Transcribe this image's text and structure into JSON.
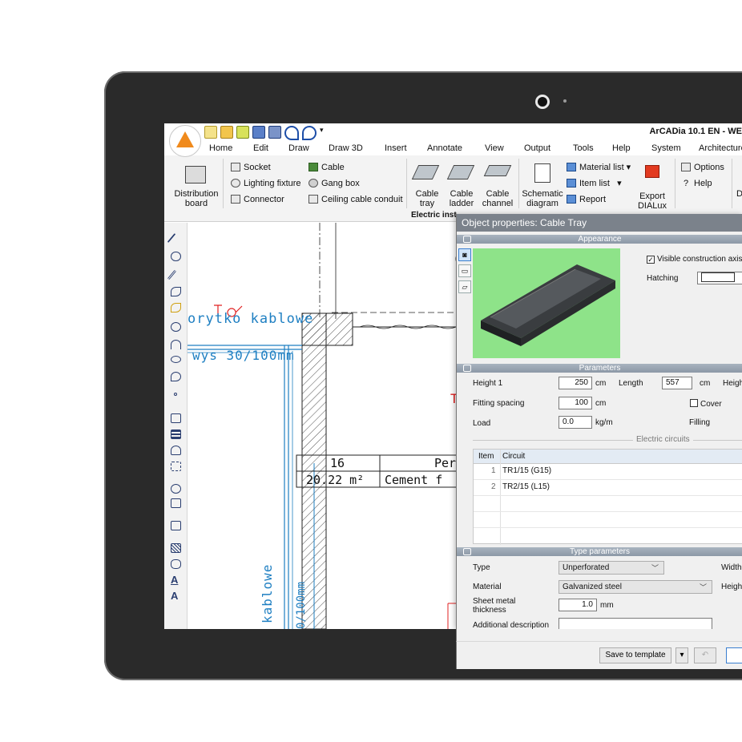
{
  "app": {
    "title": "ArCADia 10.1 EN - WE"
  },
  "menu": [
    "Home",
    "Edit",
    "Draw",
    "Draw 3D",
    "Insert",
    "Annotate",
    "View",
    "Output",
    "Tools",
    "Help",
    "System",
    "Architecture"
  ],
  "ribbon": {
    "distribution_board": "Distribution board",
    "socket": "Socket",
    "lighting_fixture": "Lighting fixture",
    "connector": "Connector",
    "cable": "Cable",
    "gang_box": "Gang box",
    "ceiling_cable_conduit": "Ceiling cable conduit",
    "cable_tray": "Cable tray",
    "cable_ladder": "Cable ladder",
    "cable_channel": "Cable channel",
    "schematic_diagram": "Schematic diagram",
    "material_list": "Material list",
    "item_list": "Item list",
    "report": "Report",
    "export_dialux": "Export DIALux",
    "options": "Options",
    "help": "Help",
    "group_label": "Electric inst",
    "trailing": "D"
  },
  "drawing": {
    "label_korytko": "orytko kablowe",
    "label_wys": "wys 30/100mm",
    "label_vertical": "kablowe",
    "label_vertical2": "0/100mm",
    "table_num": "16",
    "table_area": "20.22 m²",
    "table_col3": "Per",
    "table_col4": "Cement f",
    "red_letter": "T"
  },
  "dialog": {
    "title": "Object properties: Cable Tray",
    "sections": {
      "appearance": "Appearance",
      "parameters": "Parameters",
      "type_parameters": "Type parameters"
    },
    "appearance": {
      "visible_axis": "Visible construction axis",
      "hatching_label": "Hatching"
    },
    "parameters": {
      "height1_label": "Height 1",
      "height1_value": "250",
      "height1_unit": "cm",
      "length_label": "Length",
      "length_value": "557",
      "length_unit": "cm",
      "height_trunc": "Heigh",
      "fitting_label": "Fitting spacing",
      "fitting_value": "100",
      "fitting_unit": "cm",
      "cover_label": "Cover",
      "load_label": "Load",
      "load_value": "0.0",
      "load_unit": "kg/m",
      "filling_label": "Filling",
      "circuits_label": "Electric circuits"
    },
    "circuits": {
      "headers": [
        "Item",
        "Circuit"
      ],
      "rows": [
        {
          "item": "1",
          "circuit": "TR1/15 (G15)"
        },
        {
          "item": "2",
          "circuit": "TR2/15 (L15)"
        }
      ]
    },
    "type_parameters": {
      "type_label": "Type",
      "type_value": "Unperforated",
      "width_trunc": "Width",
      "material_label": "Material",
      "material_value": "Galvanized steel",
      "height_trunc": "Heigh",
      "thickness_label": "Sheet metal thickness",
      "thickness_value": "1.0",
      "thickness_unit": "mm",
      "description_label": "Additional description",
      "description_value": ""
    },
    "buttons": {
      "save_template": "Save to template"
    }
  },
  "colors": {
    "tablet_bezel": "#2a2a2a",
    "accent_orange": "#f08a1c",
    "dialog_title": "#7b828b",
    "drawing_blue": "#1e7fc2",
    "drawing_red": "#e02020",
    "preview_green": "#8ee389"
  }
}
